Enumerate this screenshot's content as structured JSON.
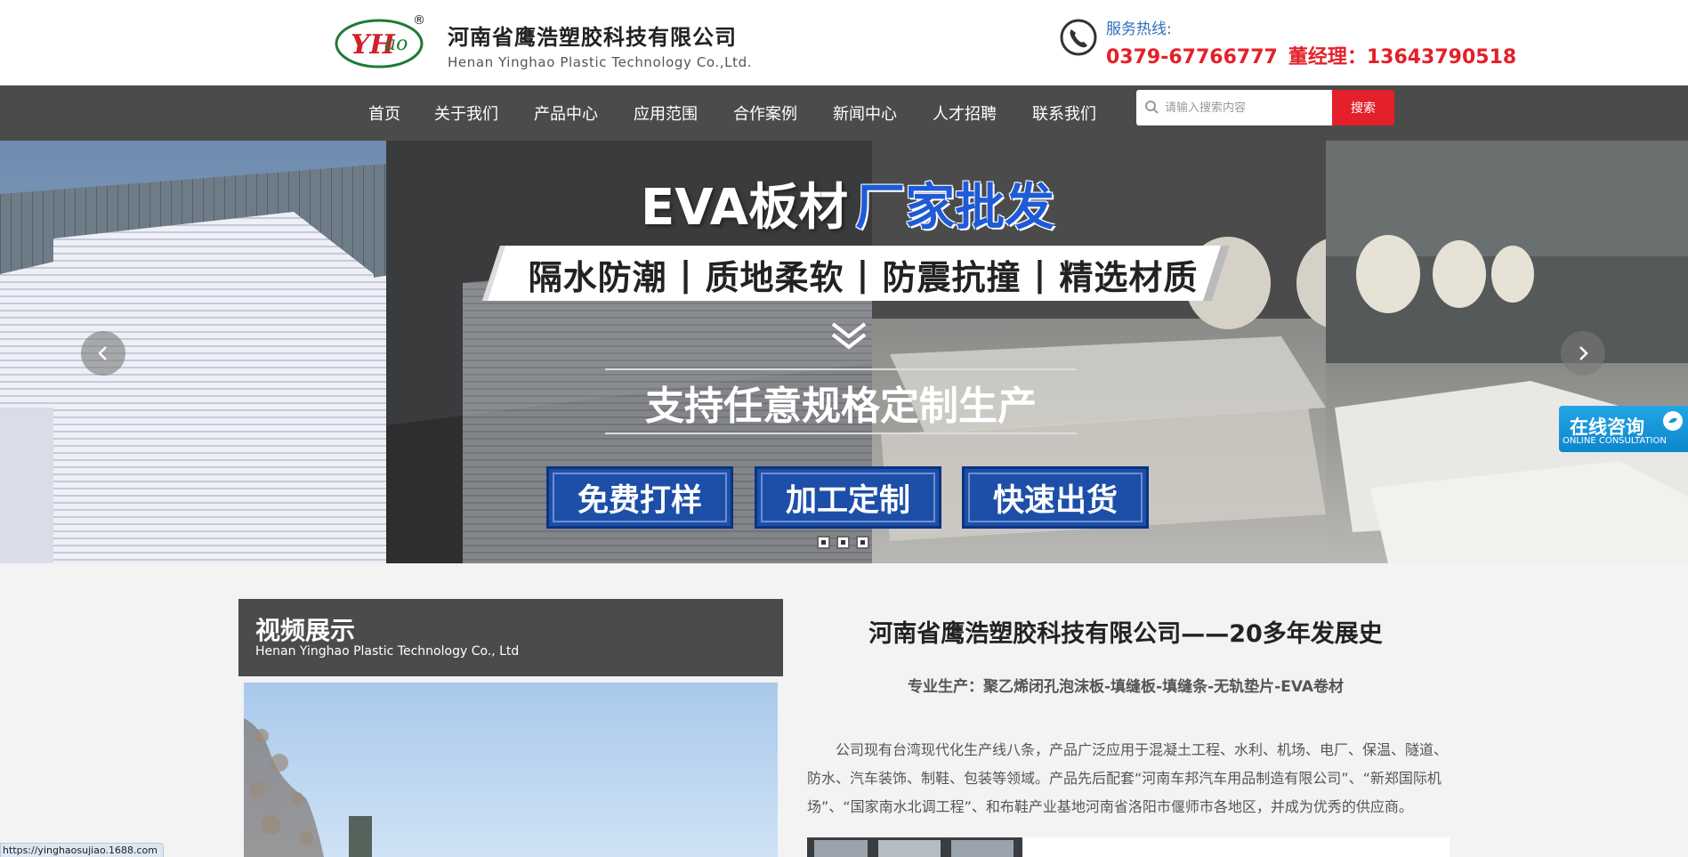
{
  "header": {
    "company_cn": "河南省鹰浩塑胶科技有限公司",
    "company_en": "Henan Yinghao Plastic Technology Co.,Ltd.",
    "logo_text": "YHao",
    "hotline_label": "服务热线:",
    "hotline_phone": "0379-67766777",
    "hotline_manager": "董经理：13643790518"
  },
  "nav": {
    "items": [
      "首页",
      "关于我们",
      "产品中心",
      "应用范围",
      "合作案例",
      "新闻中心",
      "人才招聘",
      "联系我们"
    ],
    "search_placeholder": "请输入搜索内容",
    "search_button": "搜索"
  },
  "banner": {
    "title_main": "EVA板材",
    "title_highlight": "厂家批发",
    "features": [
      "隔水防潮",
      "质地柔软",
      "防震抗撞",
      "精选材质"
    ],
    "separator": "|",
    "custom_text": "支持任意规格定制生产",
    "buttons": [
      "免费打样",
      "加工定制",
      "快速出货"
    ],
    "slide_count": 3,
    "active_slide": 1
  },
  "online": {
    "cn": "在线咨询",
    "en": "ONLINE CONSULTATION"
  },
  "video": {
    "title": "视频展示",
    "subtitle": "Henan Yinghao Plastic Technology Co., Ltd"
  },
  "about": {
    "title": "河南省鹰浩塑胶科技有限公司——20多年发展史",
    "subtitle": "专业生产：聚乙烯闭孔泡沫板-填缝板-填缝条-无轨垫片-EVA卷材",
    "body": "公司现有台湾现代化生产线八条，产品广泛应用于混凝土工程、水利、机场、电厂、保温、隧道、防水、汽车装饰、制鞋、包装等领域。产品先后配套“河南车邦汽车用品制造有限公司”、“新郑国际机场”、“国家南水北调工程”、和布鞋产业基地河南省洛阳市偃师市各地区，并成为优秀的供应商。"
  },
  "status_bar": {
    "url": "https://yinghaosujiao.1688.com"
  },
  "colors": {
    "nav_bg": "#4b4b4b",
    "accent_red": "#e4202a",
    "banner_button_blue": "#1d4fa8",
    "online_blue": "#1497d8"
  }
}
